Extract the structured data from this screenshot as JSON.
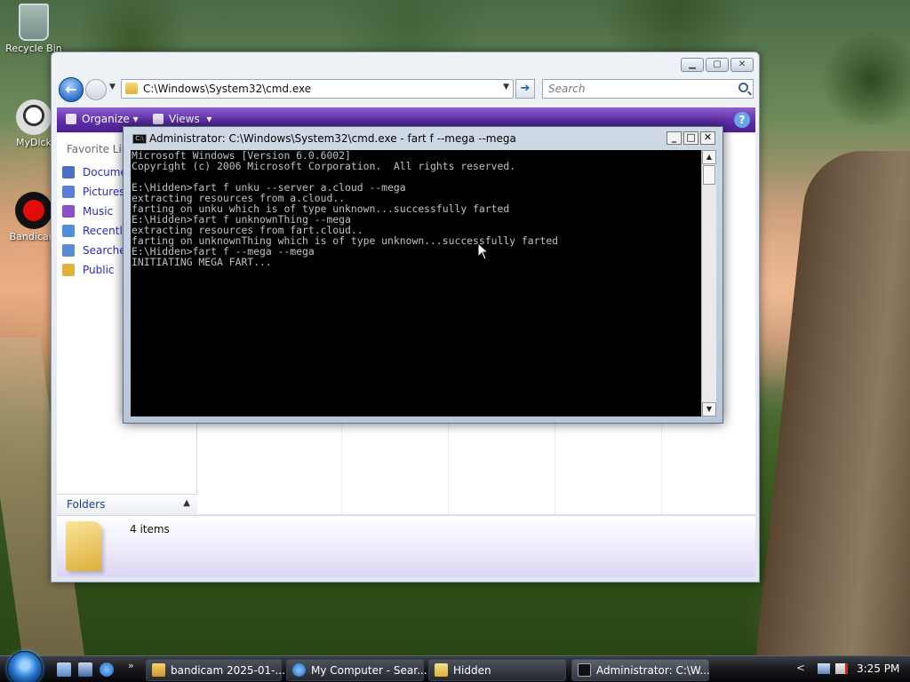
{
  "desktop": {
    "icons": [
      {
        "label": "Recycle Bin",
        "icon": "recycle-bin-icon"
      },
      {
        "label": "MyDick",
        "icon": "shortcut-icon"
      },
      {
        "label": "Bandicam",
        "icon": "bandicam-icon"
      }
    ]
  },
  "explorer": {
    "address": "C:\\Windows\\System32\\cmd.exe",
    "search_placeholder": "Search",
    "toolbar": {
      "organize": "Organize",
      "views": "Views"
    },
    "favorites_heading": "Favorite Links",
    "favorites": [
      {
        "label": "Documents",
        "icon": "documents-icon",
        "color": "#4a6fc4"
      },
      {
        "label": "Pictures",
        "icon": "pictures-icon",
        "color": "#5b7fd6"
      },
      {
        "label": "Music",
        "icon": "music-icon",
        "color": "#8d4fc8"
      },
      {
        "label": "Recently Changed",
        "icon": "recent-icon",
        "color": "#4f8fd6"
      },
      {
        "label": "Searches",
        "icon": "searches-icon",
        "color": "#5b8ad0"
      },
      {
        "label": "Public",
        "icon": "folder-icon",
        "color": "#e2b33b"
      }
    ],
    "folders_label": "Folders",
    "item_count": "4 items"
  },
  "console": {
    "title": "Administrator: C:\\Windows\\System32\\cmd.exe - fart  f --mega --mega",
    "lines": [
      "Microsoft Windows [Version 6.0.6002]",
      "Copyright (c) 2006 Microsoft Corporation.  All rights reserved.",
      "",
      "E:\\Hidden>fart f unku --server a.cloud --mega",
      "extracting resources from a.cloud..",
      "farting on unku which is of type unknown...successfully farted",
      "E:\\Hidden>fart f unknownThing --mega",
      "extracting resources from fart.cloud..",
      "farting on unknownThing which is of type unknown...successfully farted",
      "E:\\Hidden>fart f --mega --mega",
      "INITIATING MEGA FART..."
    ]
  },
  "taskbar": {
    "buttons": [
      {
        "label": "bandicam 2025-01-...",
        "icon": "bandicam-task-icon"
      },
      {
        "label": "My Computer - Sear...",
        "icon": "ie-task-icon"
      },
      {
        "label": "Hidden",
        "icon": "folder-task-icon"
      },
      {
        "label": "Administrator: C:\\W...",
        "icon": "cmd-task-icon"
      }
    ],
    "clock": "3:25 PM"
  },
  "colors": {
    "toolbar_purple": "#5e2ea8",
    "console_bg": "#000000",
    "console_text": "#c0c0c0",
    "link_blue": "#2a2ac0"
  }
}
